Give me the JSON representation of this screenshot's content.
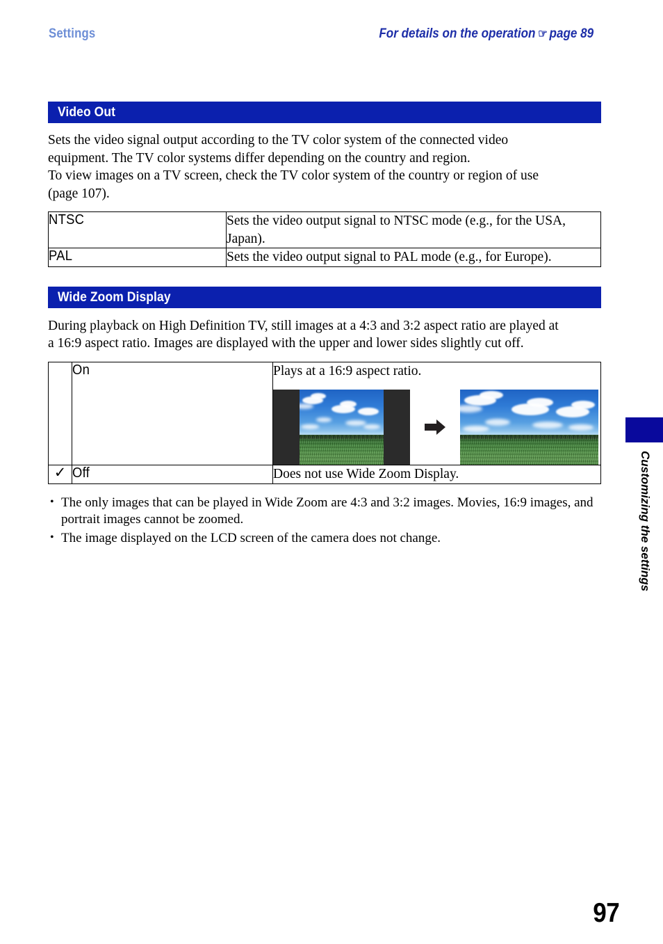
{
  "header": {
    "left_label": "Settings",
    "right_label_prefix": "For details on the operation",
    "right_icon": "pointing-hand-icon",
    "right_icon_glyph": "☞",
    "right_label_suffix": "page 89",
    "left_color": "#6d8ed6",
    "right_color": "#1d2ea8"
  },
  "sections": [
    {
      "title": "Video Out",
      "bar_color": "#0b20ae",
      "intro": "Sets the video signal output according to the TV color system of the connected video equipment. The TV color systems differ depending on the country and region.\nTo view images on a TV screen, check the TV color system of the country or region of use (page 107).",
      "intro_lines": [
        "Sets the video signal output according to the TV color system of the connected video",
        "equipment. The TV color systems differ depending on the country and region.",
        "To view images on a TV screen, check the TV color system of the country or region of use",
        "(page 107)."
      ],
      "table": {
        "has_check_column": false,
        "rows": [
          {
            "checked": false,
            "option": "NTSC",
            "description": "Sets the video output signal to NTSC mode (e.g., for the USA, Japan)."
          },
          {
            "checked": false,
            "option": "PAL",
            "description": "Sets the video output signal to PAL mode (e.g., for Europe)."
          }
        ]
      }
    },
    {
      "title": "Wide Zoom Display",
      "bar_color": "#0b20ae",
      "intro_lines": [
        "During playback on High Definition TV, still images at a 4:3 and 3:2 aspect ratio are played at",
        "a 16:9 aspect ratio. Images are displayed with the upper and lower sides slightly cut off."
      ],
      "table": {
        "has_check_column": true,
        "rows": [
          {
            "checked": false,
            "check_glyph": "",
            "option": "On",
            "description": "Plays at a 16:9 aspect ratio.",
            "figure": {
              "before_caption": "4:3 image letterboxed with black side bars",
              "arrow": "right-arrow-icon",
              "after_caption": "16:9 image filling the frame",
              "scene": "blue sky with white clouds above a green cornfield"
            }
          },
          {
            "checked": true,
            "check_glyph": "✓",
            "option": "Off",
            "description": "Does not use Wide Zoom Display."
          }
        ]
      },
      "notes": [
        "The only images that can be played in Wide Zoom are 4:3 and 3:2 images. Movies, 16:9 images, and portrait images cannot be zoomed.",
        "The image displayed on the LCD screen of the camera does not change."
      ]
    }
  ],
  "side_tab": {
    "label": "Customizing the settings",
    "color": "#09099c"
  },
  "folio": {
    "page_number": "97"
  }
}
